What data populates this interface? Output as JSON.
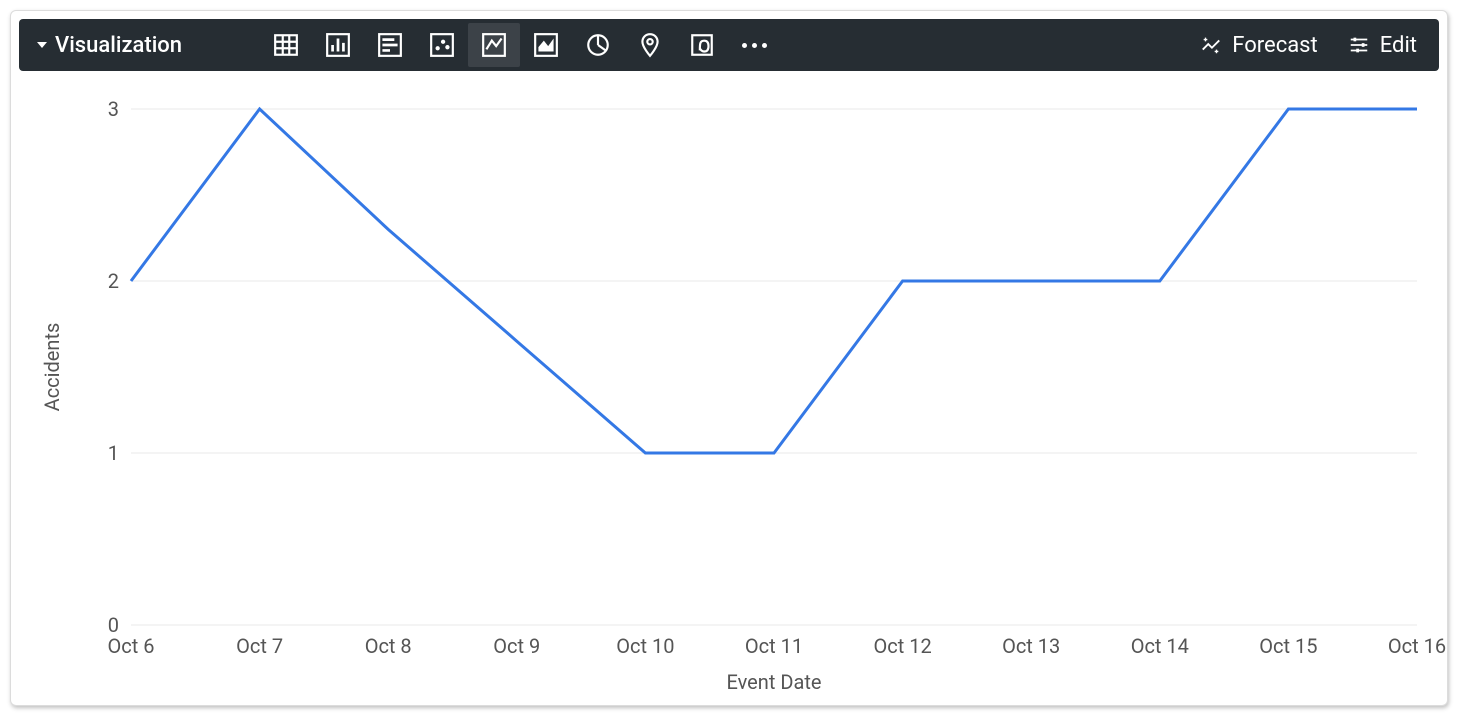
{
  "toolbar": {
    "title": "Visualization",
    "forecast_label": "Forecast",
    "edit_label": "Edit"
  },
  "chart_data": {
    "type": "line",
    "categories": [
      "Oct 6",
      "Oct 7",
      "Oct 8",
      "Oct 9",
      "Oct 10",
      "Oct 11",
      "Oct 12",
      "Oct 13",
      "Oct 14",
      "Oct 15",
      "Oct 16"
    ],
    "values": [
      2,
      3,
      2.3,
      1.65,
      1,
      1,
      2,
      2,
      2,
      3,
      3
    ],
    "xlabel": "Event Date",
    "ylabel": "Accidents",
    "ylim": [
      0,
      3
    ],
    "yticks": [
      0,
      1,
      2,
      3
    ],
    "line_color": "#3478e5"
  }
}
